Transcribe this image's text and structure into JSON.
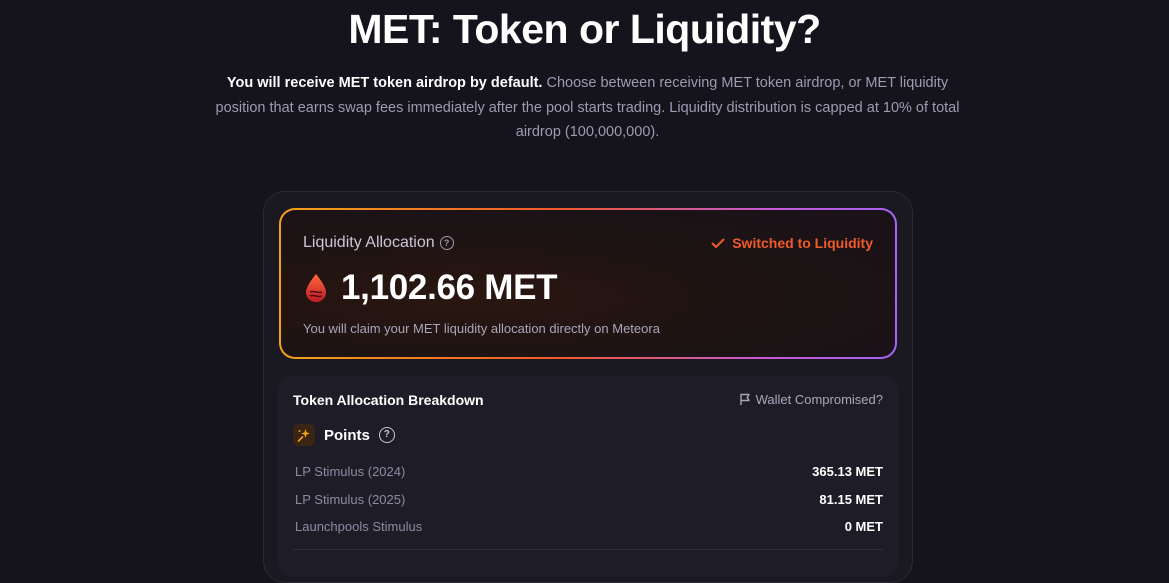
{
  "page": {
    "title": "MET: Token or Liquidity?",
    "subtitle_lead": "You will receive MET token airdrop by default.",
    "subtitle_rest": "Choose between receiving MET token airdrop, or MET liquidity position that earns swap fees immediately after the pool starts trading. Liquidity distribution is capped at 10% of total airdrop (100,000,000)."
  },
  "allocation": {
    "label": "Liquidity Allocation",
    "status": "Switched to Liquidity",
    "amount": "1,102.66 MET",
    "claim_note": "You will claim your MET liquidity allocation directly on Meteora"
  },
  "breakdown": {
    "title": "Token Allocation Breakdown",
    "wallet_link": "Wallet Compromised?",
    "section_label": "Points",
    "rows": [
      {
        "name": "LP Stimulus (2024)",
        "value": "365.13 MET"
      },
      {
        "name": "LP Stimulus (2025)",
        "value": "81.15 MET"
      },
      {
        "name": "Launchpools Stimulus",
        "value": "0 MET"
      }
    ]
  },
  "icons": {
    "help": "question-circle-icon",
    "status": "check-icon",
    "token": "droplet-icon",
    "wallet": "flag-icon",
    "points": "sparkle-icon"
  },
  "colors": {
    "background": "#15141c",
    "accent_orange": "#f05a2a",
    "gradient_start": "#f6a11a",
    "gradient_end": "#a463f2",
    "muted_text": "#9d9bb2"
  }
}
